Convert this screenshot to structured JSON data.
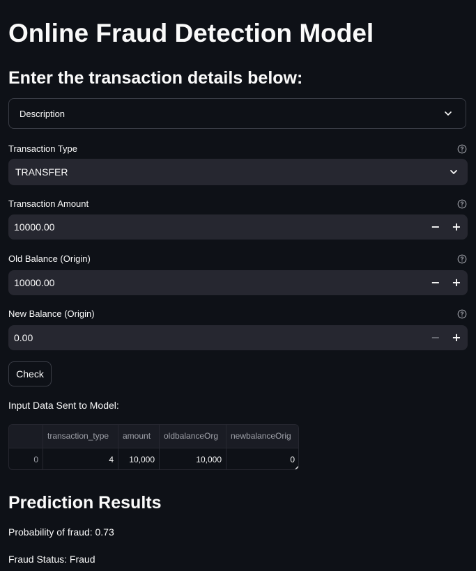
{
  "app": {
    "title": "Online Fraud Detection Model",
    "subtitle": "Enter the transaction details below:"
  },
  "expander": {
    "label": "Description"
  },
  "fields": {
    "transaction_type": {
      "label": "Transaction Type",
      "value": "TRANSFER"
    },
    "amount": {
      "label": "Transaction Amount",
      "value": "10000.00"
    },
    "old_balance": {
      "label": "Old Balance (Origin)",
      "value": "10000.00"
    },
    "new_balance": {
      "label": "New Balance (Origin)",
      "value": "0.00"
    }
  },
  "buttons": {
    "check": "Check",
    "minus": "−",
    "plus": "+"
  },
  "input_table": {
    "caption": "Input Data Sent to Model:",
    "columns": [
      "",
      "transaction_type",
      "amount",
      "oldbalanceOrg",
      "newbalanceOrig"
    ],
    "rows": [
      [
        "0",
        "4",
        "10,000",
        "10,000",
        "0"
      ]
    ]
  },
  "results": {
    "title": "Prediction Results",
    "probability": "Probability of fraud: 0.73",
    "status": "Fraud Status: Fraud"
  },
  "colors": {
    "background": "#0e1117",
    "input_bg": "#262730",
    "text": "#fafafa"
  },
  "icons": {
    "expander": "chevron-down-icon",
    "select": "chevron-down-icon",
    "help": "question-circle-icon"
  }
}
